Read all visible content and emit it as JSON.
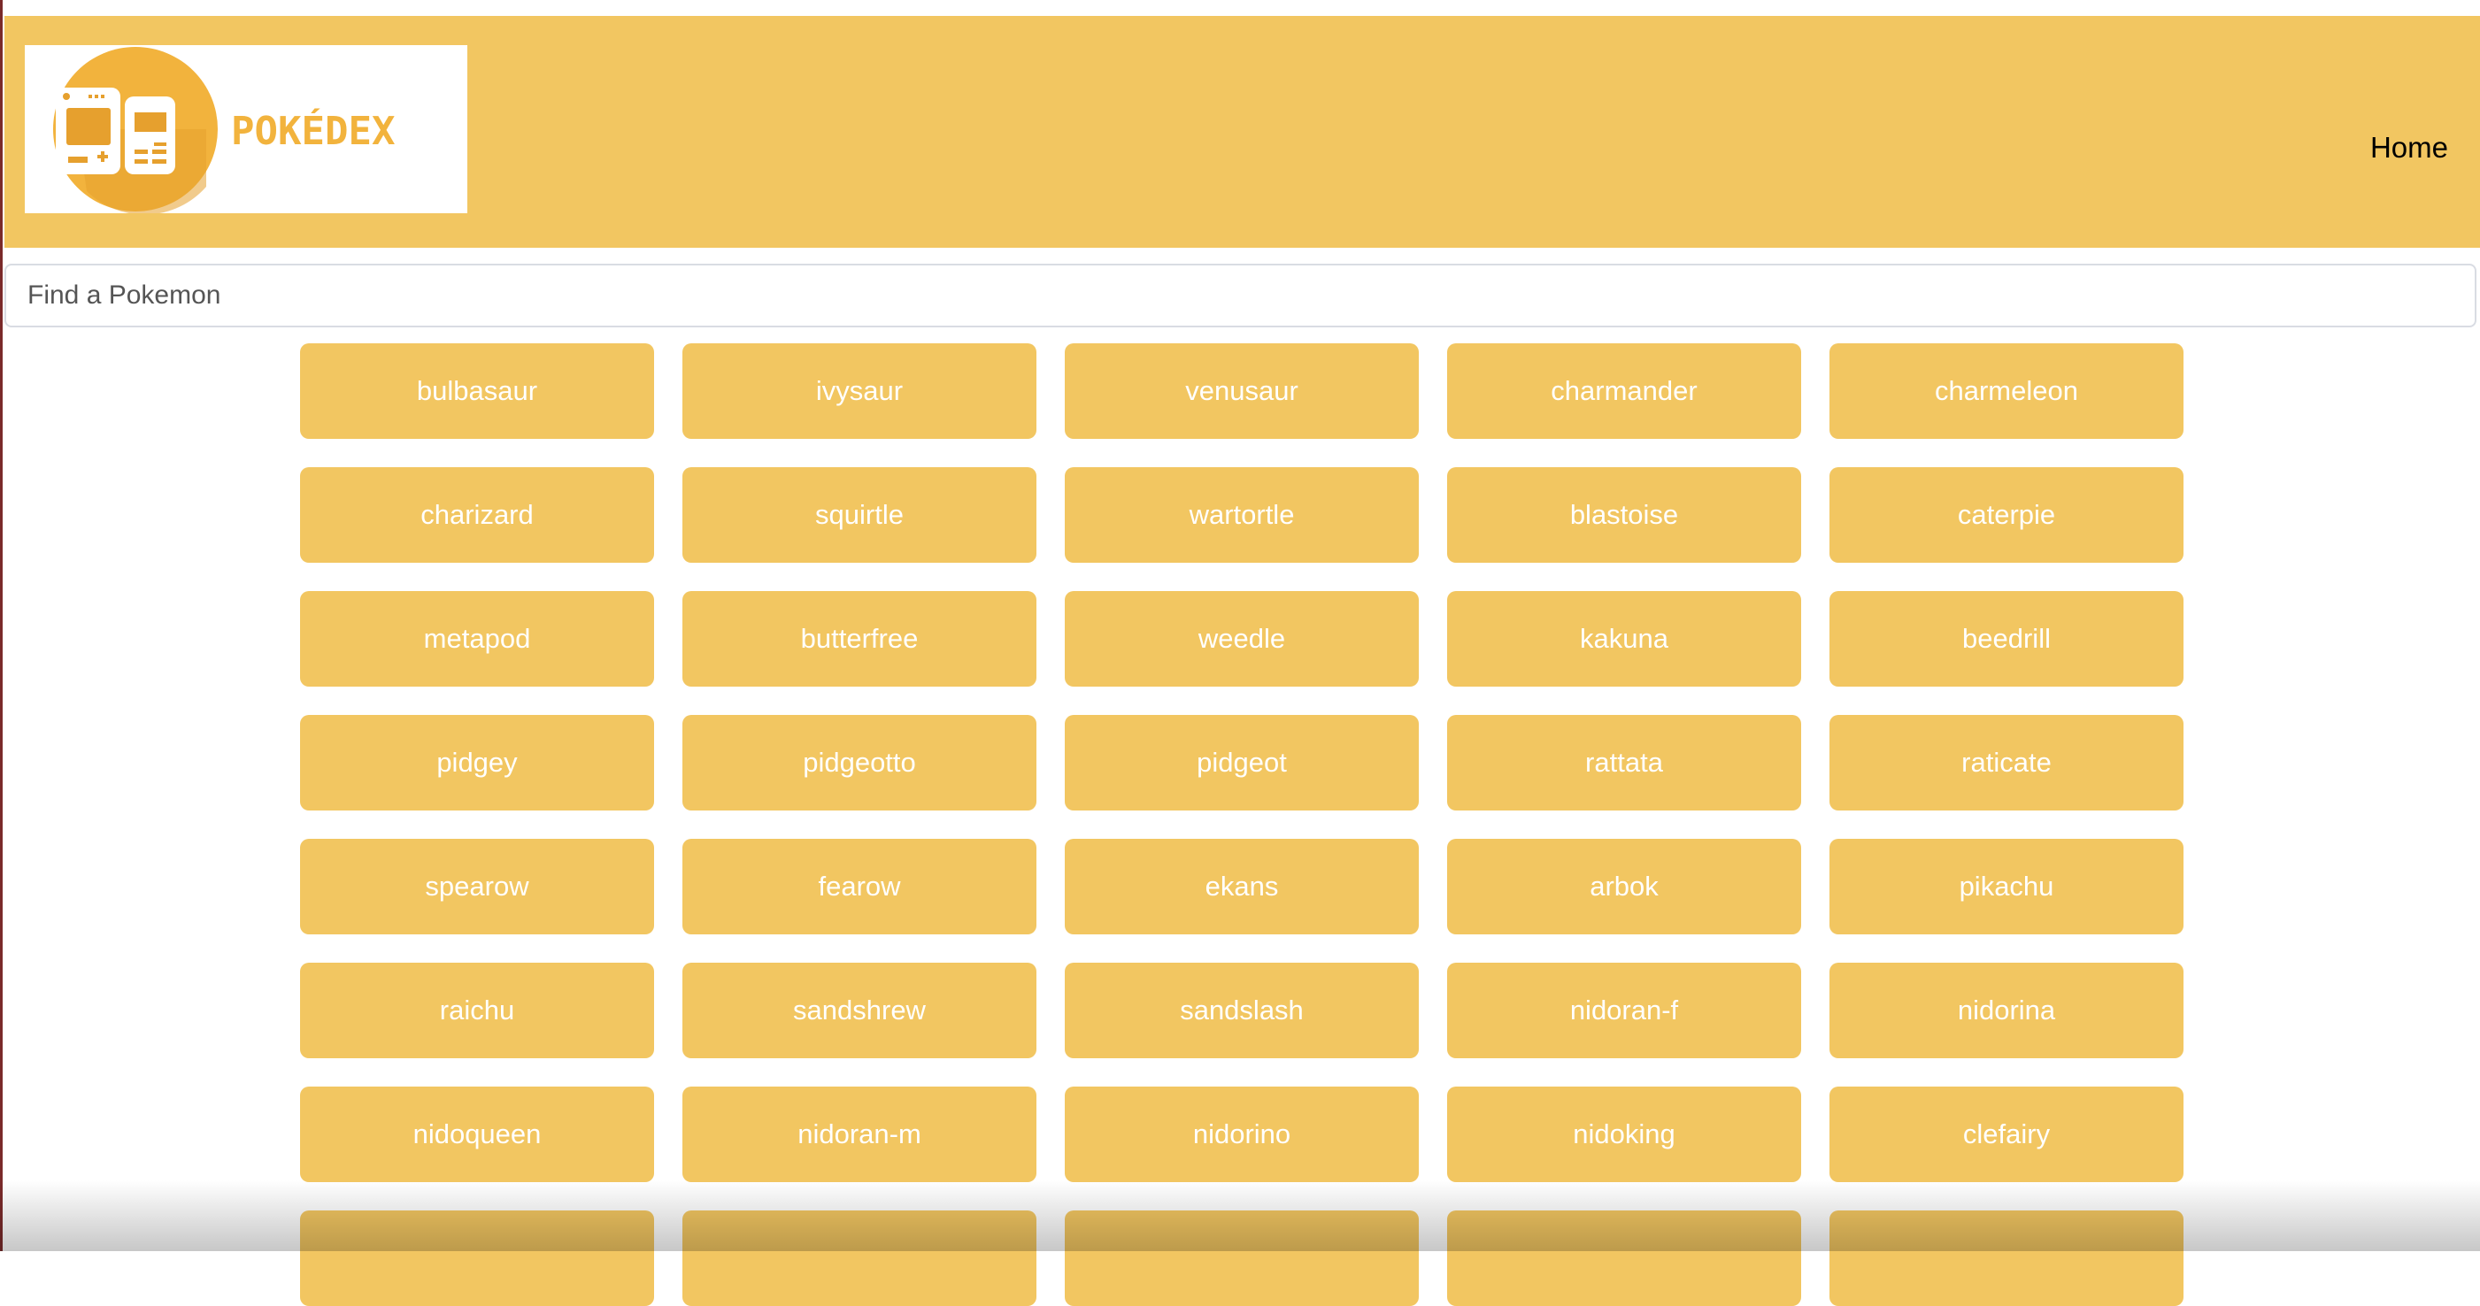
{
  "header": {
    "logo_text": "POKÉDEX",
    "nav_home": "Home",
    "bg_color": "#f2c661"
  },
  "search": {
    "placeholder": "Find a Pokemon",
    "value": ""
  },
  "pokemon": [
    "bulbasaur",
    "ivysaur",
    "venusaur",
    "charmander",
    "charmeleon",
    "charizard",
    "squirtle",
    "wartortle",
    "blastoise",
    "caterpie",
    "metapod",
    "butterfree",
    "weedle",
    "kakuna",
    "beedrill",
    "pidgey",
    "pidgeotto",
    "pidgeot",
    "rattata",
    "raticate",
    "spearow",
    "fearow",
    "ekans",
    "arbok",
    "pikachu",
    "raichu",
    "sandshrew",
    "sandslash",
    "nidoran-f",
    "nidorina",
    "nidoqueen",
    "nidoran-m",
    "nidorino",
    "nidoking",
    "clefairy",
    "",
    "",
    "",
    "",
    ""
  ],
  "colors": {
    "accent": "#f2c661",
    "button_text": "#ffffff"
  }
}
